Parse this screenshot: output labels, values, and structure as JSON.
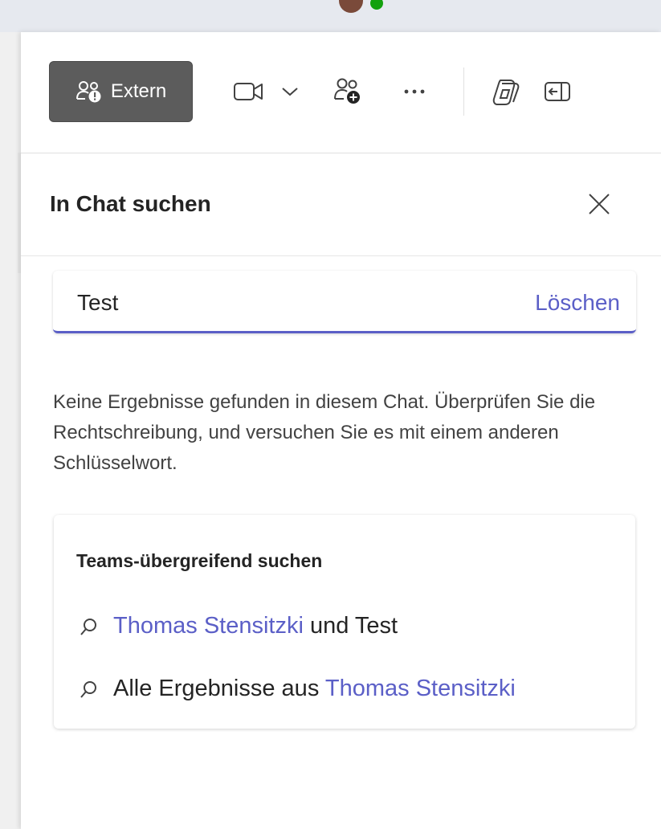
{
  "toolbar": {
    "extern_label": "Extern"
  },
  "panel": {
    "title": "In Chat suchen"
  },
  "search": {
    "value": "Test",
    "clear_label": "Löschen"
  },
  "results": {
    "message": "Keine Ergebnisse gefunden in diesem Chat. Überprüfen Sie die Rechtschreibung, und versuchen Sie es mit einem anderen Schlüsselwort."
  },
  "cross_search": {
    "title": "Teams-übergreifend suchen",
    "items": [
      {
        "link": "Thomas Stensitzki",
        "rest": "und Test"
      },
      {
        "prefix": "Alle Ergebnisse aus",
        "link": "Thomas Stensitzki"
      }
    ]
  },
  "colors": {
    "accent": "#5b5fc7",
    "extern_bg": "#5c5c5c",
    "presence": "#13a10e"
  },
  "icons": [
    "people-warning-icon",
    "video-icon",
    "chevron-down-icon",
    "add-people-icon",
    "more-icon",
    "copilot-icon",
    "collapse-pane-icon",
    "close-icon",
    "search-icon"
  ]
}
